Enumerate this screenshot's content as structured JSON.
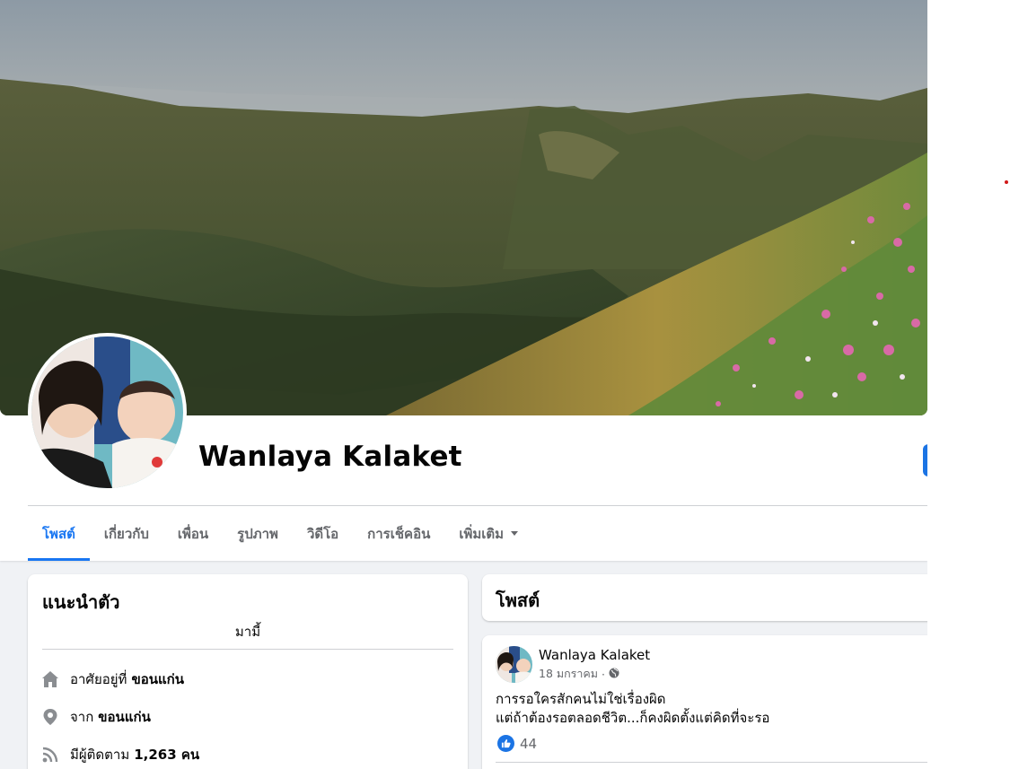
{
  "profile": {
    "name": "Wanlaya Kalaket"
  },
  "tabs": [
    {
      "label": "โพสต์",
      "active": true
    },
    {
      "label": "เกี่ยวกับ"
    },
    {
      "label": "เพื่อน"
    },
    {
      "label": "รูปภาพ"
    },
    {
      "label": "วิดีโอ"
    },
    {
      "label": "การเช็คอิน"
    },
    {
      "label": "เพิ่มเติม"
    }
  ],
  "intro": {
    "title": "แนะนำตัว",
    "bio": "มามี้",
    "lives_in_prefix": "อาศัยอยู่ที่",
    "lives_in_value": "ขอนแก่น",
    "from_prefix": "จาก",
    "from_value": "ขอนแก่น",
    "followers_prefix": "มีผู้ติดตาม",
    "followers_value": "1,263 คน"
  },
  "posts_section": {
    "title": "โพสต์"
  },
  "post": {
    "author": "Wanlaya Kalaket",
    "date": "18 มกราคม",
    "separator": "·",
    "audience_icon": "globe-icon",
    "text_line1": "การรอใครสักคนไม่ใช่เรื่องผิด",
    "text_line2": "แต่ถ้าต้องรอตลอดชีวิต...ก็คงผิดตั้งแต่คิดที่จะรอ",
    "like_count": "44"
  },
  "colors": {
    "accent": "#1876f2",
    "secondary_text": "#65676b",
    "background": "#f0f2f5",
    "divider": "#ced0d4"
  }
}
